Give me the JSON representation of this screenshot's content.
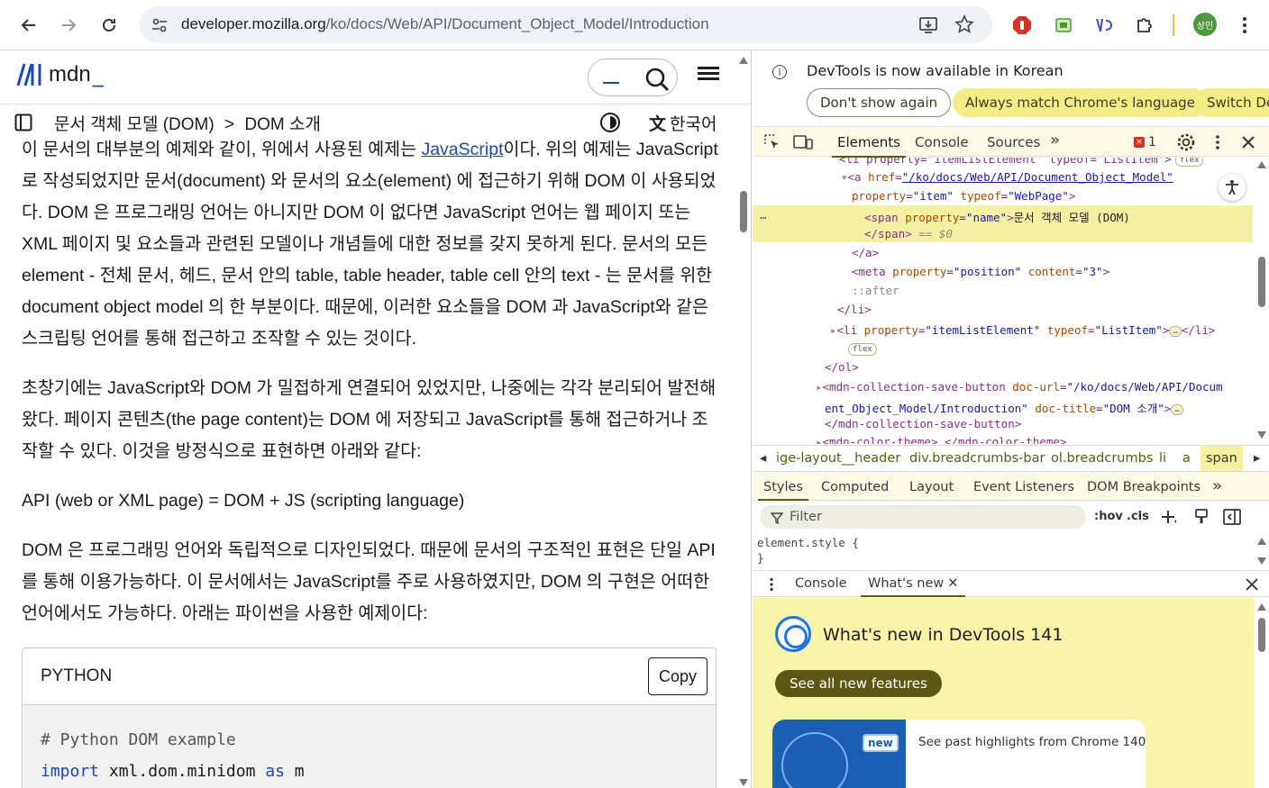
{
  "browser": {
    "url_host": "developer.mozilla.org",
    "url_path": "/ko/docs/Web/API/Document_Object_Model/Introduction",
    "avatar_label": "상민"
  },
  "mdn": {
    "logo_text": "mdn",
    "logo_underscore": "_",
    "breadcrumb_parent": "문서 객체 모델 (DOM)",
    "breadcrumb_sep": ">",
    "breadcrumb_current": "DOM 소개",
    "language": "한국어",
    "paragraphs": {
      "p1_before_link": "이 문서의 대부분의 예제와 같이, 위에서 사용된 예제는 ",
      "p1_link": "JavaScript",
      "p1_after_link": "이다. 위의 예제는 JavaScript로 작성되었지만 문서(document) 와 문서의 요소(element) 에 접근하기 위해 DOM 이 사용되었다. DOM 은 프로그래밍 언어는 아니지만 DOM 이 없다면 JavaScript 언어는 웹 페이지 또는 XML 페이지 및 요소들과 관련된 모델이나 개념들에 대한 정보를 갖지 못하게 된다. 문서의 모든 element - 전체 문서, 헤드, 문서 안의 table, table header, table cell 안의 text - 는 문서를 위한 document object model 의 한 부분이다. 때문에, 이러한 요소들을 DOM 과 JavaScript와 같은 스크립팅 언어를 통해 접근하고 조작할 수 있는 것이다.",
      "p2": "초창기에는 JavaScript와 DOM 가 밀접하게 연결되어 있었지만, 나중에는 각각 분리되어 발전해왔다. 페이지 콘텐츠(the page content)는 DOM 에 저장되고 JavaScript를 통해 접근하거나 조작할 수 있다. 이것을 방정식으로 표현하면 아래와 같다:",
      "p3": "API (web or XML page) = DOM + JS (scripting language)",
      "p4": "DOM 은 프로그래밍 언어와 독립적으로 디자인되었다. 때문에 문서의 구조적인 표현은 단일 API 를 통해 이용가능하다. 이 문서에서는 JavaScript를 주로 사용하였지만, DOM 의 구현은 어떠한 언어에서도 가능하다. 아래는 파이썬을 사용한 예제이다:"
    },
    "code": {
      "language": "PYTHON",
      "copy_label": "Copy",
      "line1": "# Python DOM example",
      "line2_kw": "import",
      "line2_mid": " xml.dom.minidom ",
      "line2_kw2": "as",
      "line2_end": " m"
    }
  },
  "devtools": {
    "info_text": "DevTools is now available in Korean",
    "btn_dont_show": "Don't show again",
    "btn_always_match": "Always match Chrome's language",
    "btn_switch": "Switch De",
    "tabs": [
      "Elements",
      "Console",
      "Sources"
    ],
    "tabs_more": "»",
    "error_count": "1",
    "dom_lines": {
      "l0": "<li property=\"itemListElement\" typeof=\"ListItem\">",
      "l1_tag": "<a",
      "l1_attr": "href",
      "l1_val": "\"/ko/docs/Web/API/Document_Object_Model\"",
      "l2_attr1": "property",
      "l2_val1": "\"item\"",
      "l2_attr2": "typeof",
      "l2_val2": "\"WebPage\"",
      "l3_tag": "<span",
      "l3_attr": "property",
      "l3_val": "\"name\"",
      "l3_text": "문서 객체 모델 (DOM)",
      "l4_tag": "</span>",
      "l4_eq": "== $0",
      "l5": "</a>",
      "l6_tag": "<meta",
      "l6_attr1": "property",
      "l6_val1": "\"position\"",
      "l6_attr2": "content",
      "l6_val2": "\"3\"",
      "l7": "::after",
      "l8": "</li>",
      "l9_tag": "<li",
      "l9_attr1": "property",
      "l9_val1": "\"itemListElement\"",
      "l9_attr2": "typeof",
      "l9_val2": "\"ListItem\"",
      "l9_end": "</li>",
      "l10": "</ol>",
      "l11_tag": "<mdn-collection-save-button",
      "l11_attr": "doc-url",
      "l11_val": "\"/ko/docs/Web/API/Docum",
      "l12_val": "ent_Object_Model/Introduction\"",
      "l12_attr": "doc-title",
      "l12_val2": "\"DOM 소개\"",
      "l13": "</mdn-collection-save-button>",
      "l14": "<mdn-color-theme>…</mdn-color-theme>",
      "flex": "flex",
      "ellipsis": "…",
      "dots": "…"
    },
    "crumbs": [
      "ige-layout__header",
      "div.breadcrumbs-bar",
      "ol.breadcrumbs",
      "li",
      "a",
      "span"
    ],
    "sub_tabs": [
      "Styles",
      "Computed",
      "Layout",
      "Event Listeners",
      "DOM Breakpoints"
    ],
    "sub_tabs_more": "»",
    "filter_placeholder": "Filter",
    "hov": ":hov",
    "cls": ".cls",
    "style_rule": "element.style {",
    "style_close": "}",
    "drawer_tabs": [
      "Console",
      "What's new"
    ],
    "whatsnew_title": "What's new in DevTools 141",
    "whatsnew_button": "See all new features",
    "whatsnew_badge": "new",
    "whatsnew_card": "See past highlights from Chrome 140"
  }
}
